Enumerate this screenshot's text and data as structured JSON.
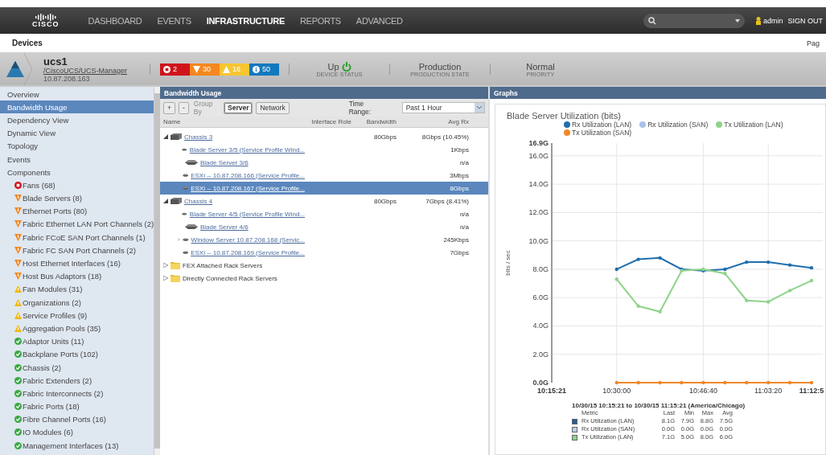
{
  "nav": {
    "items": [
      {
        "label": "DASHBOARD",
        "selected": false
      },
      {
        "label": "EVENTS",
        "selected": false
      },
      {
        "label": "INFRASTRUCTURE",
        "selected": true
      },
      {
        "label": "REPORTS",
        "selected": false
      },
      {
        "label": "ADVANCED",
        "selected": false
      }
    ],
    "logo": "CISCO",
    "user": "admin",
    "signout": "SIGN OUT"
  },
  "breadcrumb": {
    "title": "Devices",
    "right": "Pag"
  },
  "device": {
    "name": "ucs1",
    "path": "/CiscoUCS/UCS-Manager",
    "ip": "10.87.208.163",
    "alarms": [
      {
        "kind": "critical",
        "count": "2",
        "color": "#d0131b"
      },
      {
        "kind": "major",
        "count": "30",
        "color": "#f5871f"
      },
      {
        "kind": "minor",
        "count": "16",
        "color": "#f7c631"
      },
      {
        "kind": "info",
        "count": "50",
        "color": "#1478bf"
      }
    ],
    "stats": [
      {
        "value": "Up",
        "label": "DEVICE STATUS",
        "up": true
      },
      {
        "value": "Production",
        "label": "PRODUCTION STATE"
      },
      {
        "value": "Normal",
        "label": "PRIORITY"
      }
    ]
  },
  "sidebar": {
    "items": [
      {
        "label": "Overview",
        "selected": false
      },
      {
        "label": "Bandwidth Usage",
        "selected": true
      },
      {
        "label": "Dependency View",
        "selected": false
      },
      {
        "label": "Dynamic View",
        "selected": false
      },
      {
        "label": "Topology",
        "selected": false
      },
      {
        "label": "Events",
        "selected": false
      },
      {
        "label": "Components",
        "selected": false,
        "children": [
          {
            "label": "Fans (68)",
            "kind": "critical"
          },
          {
            "label": "Blade Servers (8)",
            "kind": "major"
          },
          {
            "label": "Ethernet Ports (80)",
            "kind": "major"
          },
          {
            "label": "Fabric Ethernet LAN Port Channels (2)",
            "kind": "major"
          },
          {
            "label": "Fabric FCoE SAN Port Channels (1)",
            "kind": "major"
          },
          {
            "label": "Fabric FC SAN Port Channels (2)",
            "kind": "major"
          },
          {
            "label": "Host Ethernet Interfaces (16)",
            "kind": "major"
          },
          {
            "label": "Host Bus Adaptors (18)",
            "kind": "major"
          },
          {
            "label": "Fan Modules (31)",
            "kind": "minor"
          },
          {
            "label": "Organizations (2)",
            "kind": "minor"
          },
          {
            "label": "Service Profiles (9)",
            "kind": "minor"
          },
          {
            "label": "Aggregation Pools (35)",
            "kind": "minor"
          },
          {
            "label": "Adaptor Units (11)",
            "kind": "ok"
          },
          {
            "label": "Backplane Ports (102)",
            "kind": "ok"
          },
          {
            "label": "Chassis (2)",
            "kind": "ok"
          },
          {
            "label": "Fabric Extenders (2)",
            "kind": "ok"
          },
          {
            "label": "Fabric Interconnects (2)",
            "kind": "ok"
          },
          {
            "label": "Fabric Ports (18)",
            "kind": "ok"
          },
          {
            "label": "Fibre Channel Ports (16)",
            "kind": "ok"
          },
          {
            "label": "IO Modules (6)",
            "kind": "ok"
          },
          {
            "label": "Management Interfaces (13)",
            "kind": "ok"
          }
        ]
      }
    ]
  },
  "bandwidth": {
    "title": "Bandwidth Usage",
    "group_by_label": "Group By",
    "group_by": [
      {
        "label": "Server",
        "selected": true
      },
      {
        "label": "Network",
        "selected": false
      }
    ],
    "add": "+",
    "remove": "-",
    "time_range_label": "Time Range:",
    "time_range": "Past 1 Hour",
    "columns": [
      "Name",
      "Interface Role",
      "Bandwidth",
      "Avg Rx"
    ],
    "rows": [
      {
        "name": "Chassis 3",
        "kind": "chassis",
        "expanded": true,
        "selected": false,
        "bandwidth": "80Gbps",
        "avg_rx": "8Gbps (10.45%)",
        "children": [
          {
            "name": "Blade Server 3/5 (Service Profile Wind...",
            "kind": "server",
            "selected": false,
            "avg_rx": "1Kbps"
          },
          {
            "name": "Blade Server 3/6",
            "kind": "server",
            "selected": false,
            "avg_rx": "n/a"
          },
          {
            "name": "ESXi -- 10.87.208.166 (Service Profile...",
            "kind": "server",
            "selected": false,
            "avg_rx": "3Mbps"
          },
          {
            "name": "ESXi -- 10.87.208.167 (Service Profile...",
            "kind": "server",
            "selected": true,
            "avg_rx": "8Gbps"
          }
        ]
      },
      {
        "name": "Chassis 4",
        "kind": "chassis",
        "expanded": true,
        "selected": false,
        "bandwidth": "80Gbps",
        "avg_rx": "7Gbps (8.41%)",
        "children": [
          {
            "name": "Blade Server 4/5 (Service Profile Wind...",
            "kind": "server",
            "selected": false,
            "avg_rx": "n/a"
          },
          {
            "name": "Blade Server 4/6",
            "kind": "server",
            "selected": false,
            "avg_rx": "n/a"
          },
          {
            "name": "Window Server 10.87.208.168 (Servic...",
            "kind": "server",
            "expanded": false,
            "selected": false,
            "avg_rx": "245Kbps"
          },
          {
            "name": "ESXi -- 10.87.208.169 (Service Profile...",
            "kind": "server",
            "selected": false,
            "avg_rx": "7Gbps"
          }
        ]
      },
      {
        "name": "FEX Attached Rack Servers",
        "kind": "folder",
        "expanded": false,
        "selected": false
      },
      {
        "name": "Directly Connected Rack Servers",
        "kind": "folder",
        "expanded": false,
        "selected": false
      }
    ]
  },
  "graphs": {
    "title": "Graphs",
    "chart_data": {
      "type": "line",
      "title": "Blade Server Utilization (bits)",
      "ylabel": "bits / sec",
      "categories": [
        "10:15:21",
        null,
        null,
        "10:30:00",
        null,
        null,
        null,
        "10:46:40",
        null,
        null,
        "11:03:20",
        null,
        "11:12:5"
      ],
      "series": [
        {
          "name": "Rx Utilization (LAN)",
          "color": "#1f6fae",
          "values": [
            null,
            null,
            null,
            8.0,
            8.7,
            8.8,
            8.0,
            7.9,
            8.0,
            8.5,
            8.5,
            8.3,
            8.1
          ]
        },
        {
          "name": "Rx Utilization (SAN)",
          "color": "#a9c3e8",
          "values": [
            null,
            null,
            null,
            null,
            null,
            null,
            null,
            null,
            null,
            null,
            null,
            null,
            null
          ]
        },
        {
          "name": "Tx Utilization (LAN)",
          "color": "#8fd38a",
          "values": [
            null,
            null,
            null,
            7.3,
            5.4,
            5.0,
            7.9,
            8.0,
            7.7,
            5.8,
            5.7,
            6.5,
            7.2
          ]
        },
        {
          "name": "Tx Utilization (SAN)",
          "color": "#f0882a",
          "values": [
            null,
            null,
            null,
            0,
            0,
            0,
            0,
            0,
            0,
            0,
            0,
            0,
            0
          ]
        }
      ],
      "ylim": [
        0,
        16.9
      ],
      "grid": true,
      "yticks": [
        {
          "value": 0,
          "label": "0.0G"
        },
        {
          "value": 2,
          "label": "2.0G"
        },
        {
          "value": 4,
          "label": "4.0G"
        },
        {
          "value": 6,
          "label": "6.0G"
        },
        {
          "value": 8,
          "label": "8.0G"
        },
        {
          "value": 10,
          "label": "10.0G"
        },
        {
          "value": 12,
          "label": "12.0G"
        },
        {
          "value": 14,
          "label": "14.0G"
        },
        {
          "value": 16,
          "label": "16.0G"
        },
        {
          "value": 16.9,
          "label": "16.9G"
        }
      ]
    },
    "summary": {
      "range": "10/30/15 10:15:21 to 10/30/15 11:15:21 (America/Chicago)",
      "columns": [
        "Metric",
        "Last",
        "Min",
        "Max",
        "Avg"
      ],
      "rows": [
        {
          "color": "#1f5f9a",
          "cells": [
            "Rx Utilization (LAN)",
            "8.1G",
            "7.9G",
            "8.8G",
            "7.5G"
          ]
        },
        {
          "color": "#b8cde8",
          "cells": [
            "Rx Utilization (SAN)",
            "0.0G",
            "0.0G",
            "0.0G",
            "0.0G"
          ]
        },
        {
          "color": "#8fd38a",
          "cells": [
            "Tx Utilization (LAN)",
            "7.1G",
            "5.0G",
            "8.0G",
            "6.0G"
          ]
        }
      ]
    }
  }
}
